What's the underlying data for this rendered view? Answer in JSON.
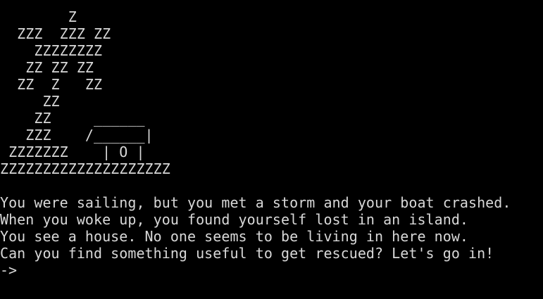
{
  "terminal": {
    "ascii_art": [
      "        Z",
      "  ZZZ  ZZZ ZZ",
      "    ZZZZZZZZ",
      "   ZZ ZZ ZZ",
      "  ZZ  Z   ZZ",
      "     ZZ",
      "    ZZ     ______",
      "   ZZZ    /______|",
      " ZZZZZZZ    | O |",
      "ZZZZZZZZZZZZZZZZZZZZ"
    ],
    "blank": "",
    "story": [
      "You were sailing, but you met a storm and your boat crashed.",
      "When you woke up, you found yourself lost in an island.",
      "You see a house. No one seems to be living in here now.",
      "Can you find something useful to get rescued? Let's go in!"
    ],
    "prompt": "->",
    "colors": {
      "background": "#000000",
      "text": "#d8d8d8"
    }
  }
}
